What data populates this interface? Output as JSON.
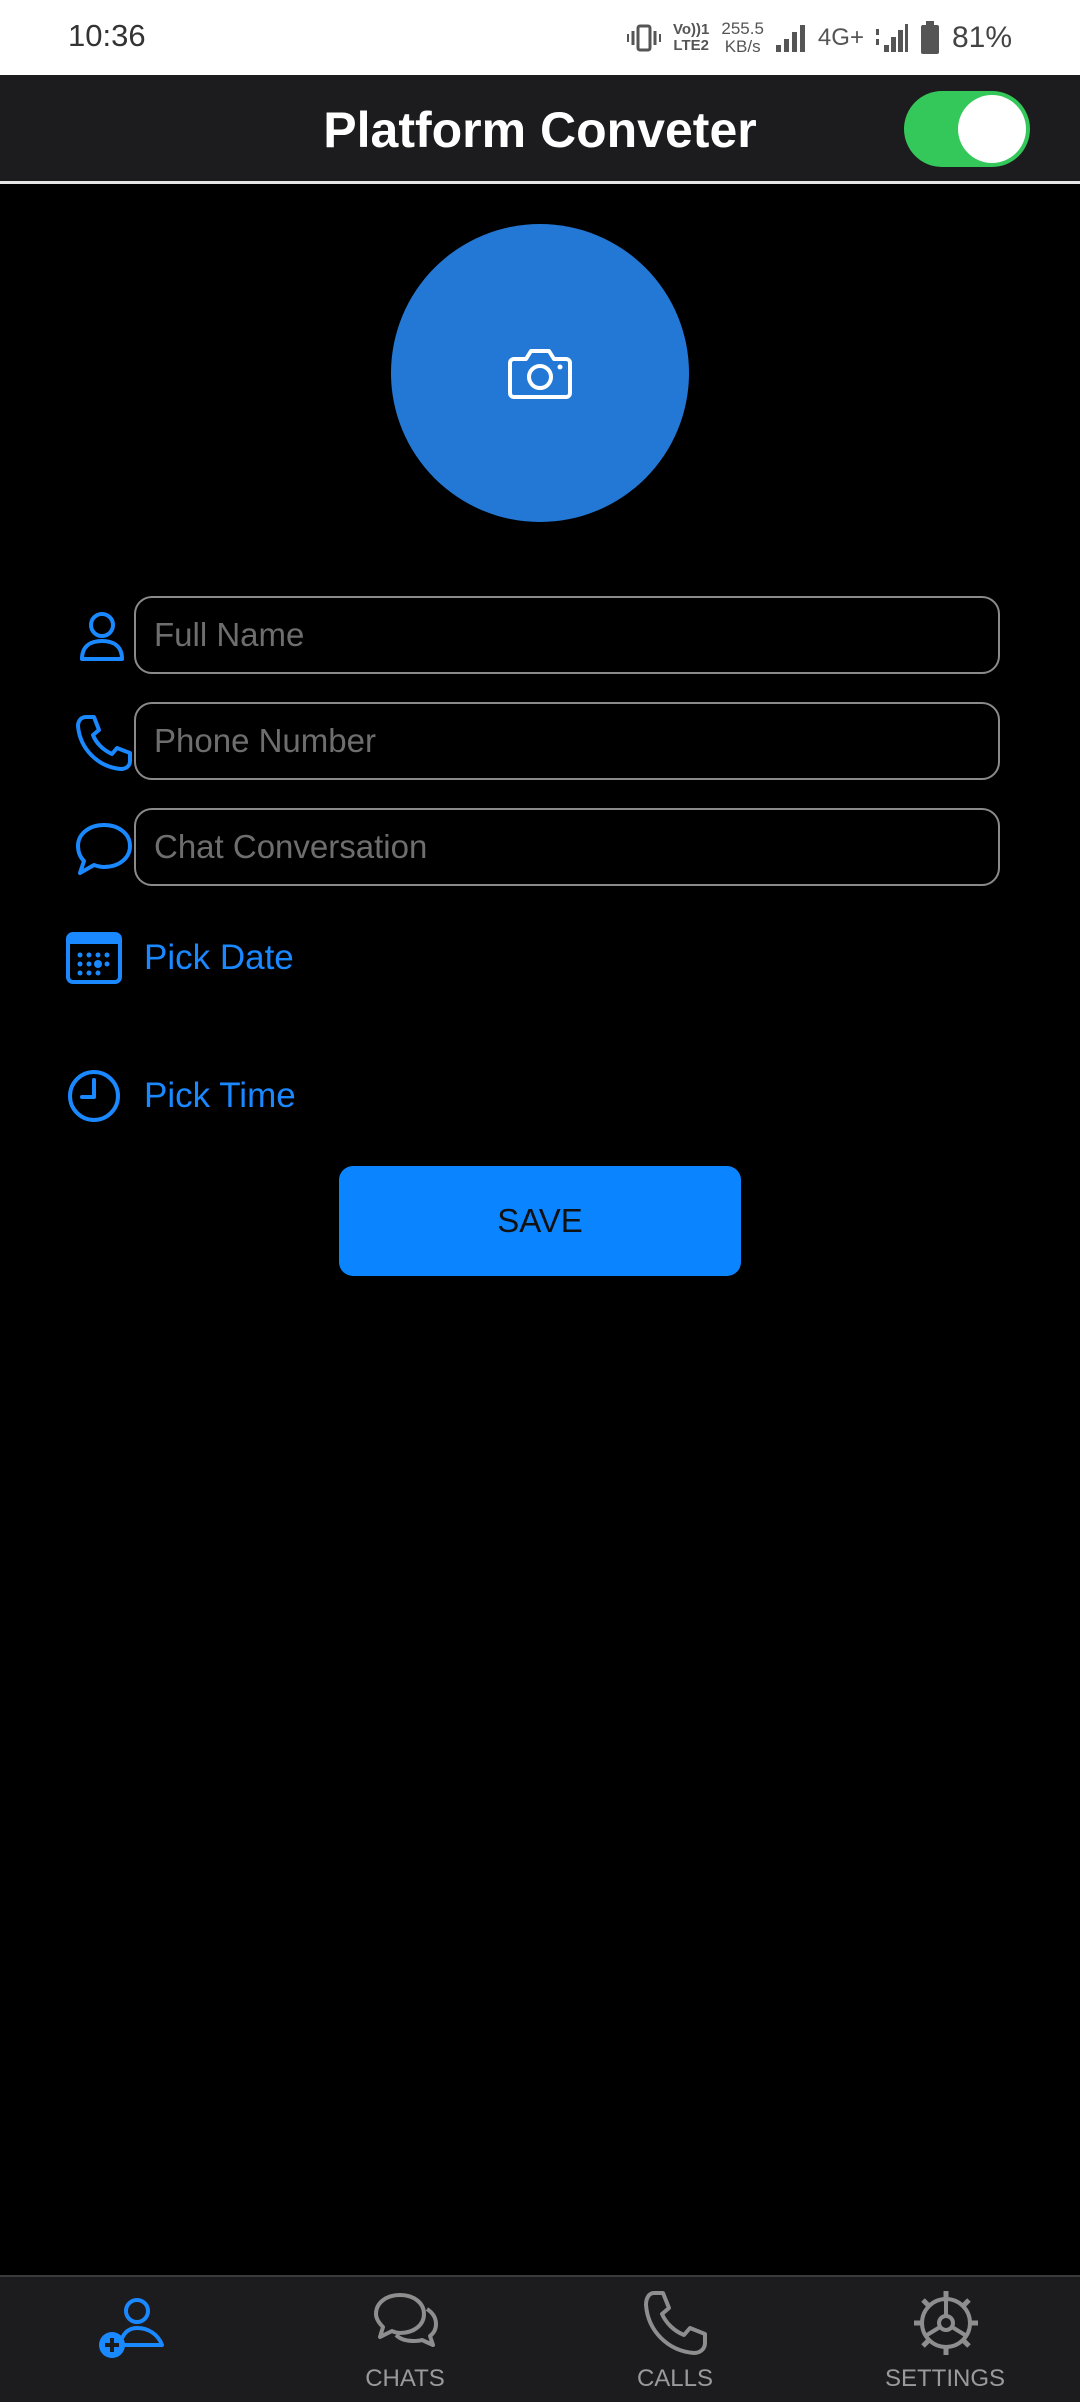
{
  "status_bar": {
    "time": "10:36",
    "volte_line1": "Vo))1",
    "volte_line2": "LTE2",
    "speed_value": "255.5",
    "speed_unit": "KB/s",
    "network": "4G+",
    "battery_percent": "81%"
  },
  "app_bar": {
    "title": "Platform Conveter",
    "toggle_on": true
  },
  "form": {
    "full_name": {
      "placeholder": "Full Name",
      "value": ""
    },
    "phone_number": {
      "placeholder": "Phone Number",
      "value": ""
    },
    "chat_conversation": {
      "placeholder": "Chat Conversation",
      "value": ""
    },
    "pick_date_label": "Pick Date",
    "pick_time_label": "Pick Time",
    "save_label": "SAVE"
  },
  "bottom_nav": {
    "items": [
      {
        "label": "",
        "icon": "add-user-icon",
        "active": true
      },
      {
        "label": "CHATS",
        "icon": "chats-icon",
        "active": false
      },
      {
        "label": "CALLS",
        "icon": "phone-icon",
        "active": false
      },
      {
        "label": "SETTINGS",
        "icon": "settings-icon",
        "active": false
      }
    ]
  },
  "colors": {
    "accent": "#0a84ff",
    "avatar_bg": "#2378d5",
    "toggle_on": "#34c759",
    "background": "#000000",
    "bar_bg": "#1c1c1e"
  }
}
